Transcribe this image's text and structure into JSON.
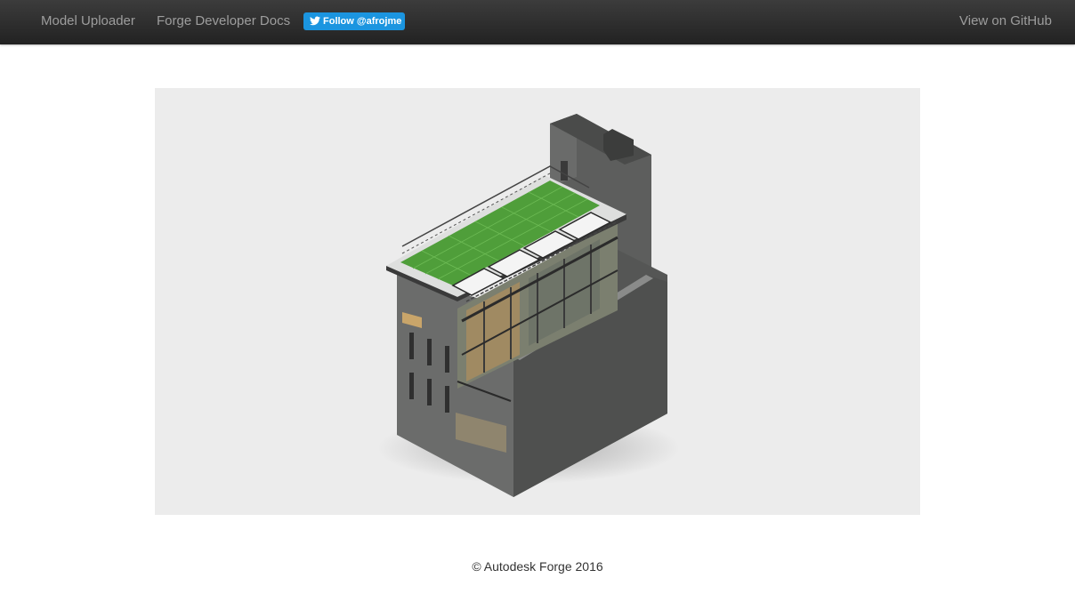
{
  "navbar": {
    "links": [
      {
        "label": "Model Uploader"
      },
      {
        "label": "Forge Developer Docs"
      }
    ],
    "twitter_button": {
      "label": "Follow @afrojme",
      "icon": "twitter-bird-icon"
    },
    "github_link": {
      "label": "View on GitHub"
    }
  },
  "viewer": {
    "content": "3d-building-model"
  },
  "footer": {
    "text": "© Autodesk Forge 2016"
  },
  "colors": {
    "navbar": "#222222",
    "nav_text": "#9d9d9d",
    "twitter_blue": "#1b95e0",
    "viewer_bg": "#ececec",
    "roof_green": "#4f9e3a",
    "building_gray": "#5a5b5a"
  }
}
